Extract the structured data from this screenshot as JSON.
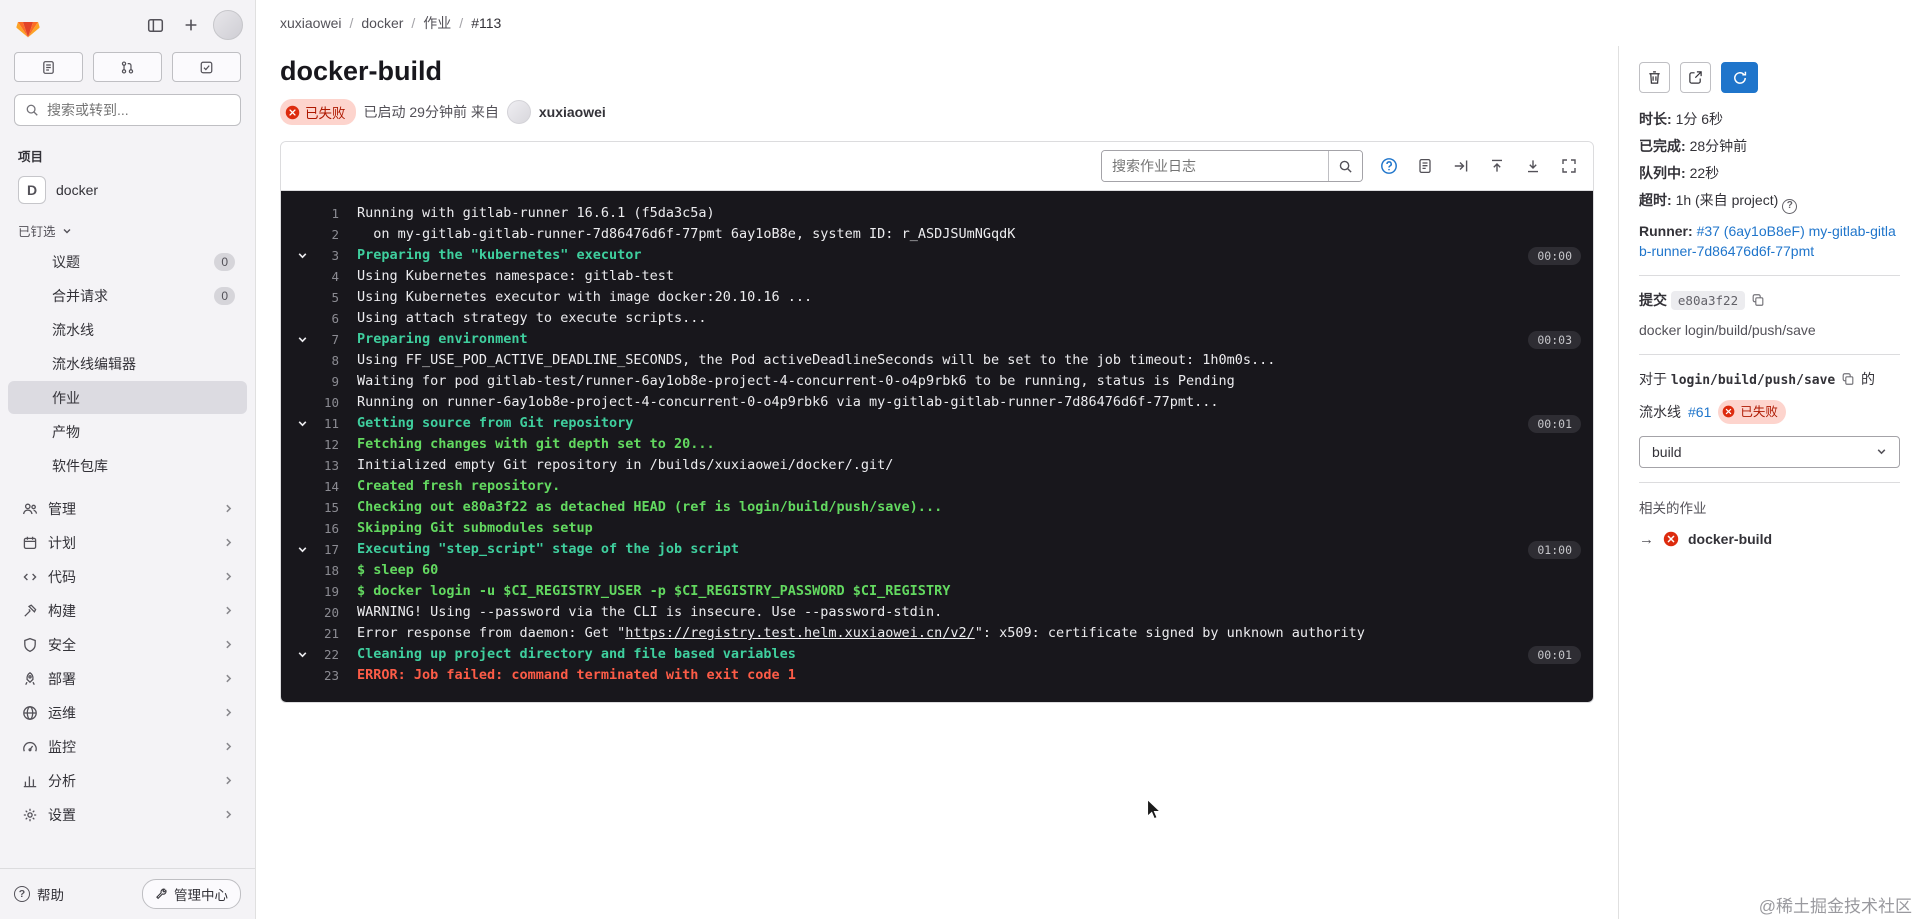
{
  "colors": {
    "accent_blue": "#1f75cb",
    "failed_red": "#dd2b0e",
    "failed_badge_bg": "#fdd4cd",
    "console_bg": "#18171c",
    "console_section_green": "#3fcf9e",
    "console_command_green": "#63d960",
    "console_error_red": "#fd5c47",
    "sidebar_bg": "#f4f3f6"
  },
  "breadcrumb": [
    "xuxiaowei",
    "docker",
    "作业",
    "#113"
  ],
  "sidebar": {
    "search_placeholder": "搜索或转到...",
    "section_label": "项目",
    "project": {
      "initial": "D",
      "name": "docker"
    },
    "pinned_label": "已钉选",
    "pinned_items": [
      {
        "key": "issues",
        "label": "议题",
        "badge": "0"
      },
      {
        "key": "merge-requests",
        "label": "合并请求",
        "badge": "0"
      },
      {
        "key": "pipelines",
        "label": "流水线"
      },
      {
        "key": "pipeline-editor",
        "label": "流水线编辑器"
      },
      {
        "key": "jobs",
        "label": "作业",
        "active": true
      },
      {
        "key": "artifacts",
        "label": "产物"
      },
      {
        "key": "package-registry",
        "label": "软件包库"
      }
    ],
    "menu_items": [
      {
        "key": "manage",
        "label": "管理",
        "icon": "users-icon"
      },
      {
        "key": "plan",
        "label": "计划",
        "icon": "calendar-icon"
      },
      {
        "key": "code",
        "label": "代码",
        "icon": "code-icon"
      },
      {
        "key": "build",
        "label": "构建",
        "icon": "hammer-icon"
      },
      {
        "key": "secure",
        "label": "安全",
        "icon": "shield-icon"
      },
      {
        "key": "deploy",
        "label": "部署",
        "icon": "rocket-icon"
      },
      {
        "key": "operate",
        "label": "运维",
        "icon": "globe-icon"
      },
      {
        "key": "monitor",
        "label": "监控",
        "icon": "gauge-icon"
      },
      {
        "key": "analyze",
        "label": "分析",
        "icon": "chart-icon"
      },
      {
        "key": "settings",
        "label": "设置",
        "icon": "gear-icon"
      }
    ],
    "footer": {
      "help": "帮助",
      "admin": "管理中心"
    }
  },
  "job": {
    "title": "docker-build",
    "status": "已失败",
    "started_text": "已启动 29分钟前 来自",
    "user": "xuxiaowei",
    "log_search_placeholder": "搜索作业日志"
  },
  "log": {
    "lines": [
      {
        "n": 1,
        "type": "normal",
        "text": "Running with gitlab-runner 16.6.1 (f5da3c5a)"
      },
      {
        "n": 2,
        "type": "normal",
        "text": "  on my-gitlab-gitlab-runner-7d86476d6f-77pmt 6ay1oB8e, system ID: r_ASDJSUmNGqdK"
      },
      {
        "n": 3,
        "type": "section",
        "text": "Preparing the \"kubernetes\" executor",
        "duration": "00:00"
      },
      {
        "n": 4,
        "type": "normal",
        "text": "Using Kubernetes namespace: gitlab-test"
      },
      {
        "n": 5,
        "type": "normal",
        "text": "Using Kubernetes executor with image docker:20.10.16 ..."
      },
      {
        "n": 6,
        "type": "normal",
        "text": "Using attach strategy to execute scripts..."
      },
      {
        "n": 7,
        "type": "section",
        "text": "Preparing environment",
        "duration": "00:03"
      },
      {
        "n": 8,
        "type": "normal",
        "text": "Using FF_USE_POD_ACTIVE_DEADLINE_SECONDS, the Pod activeDeadlineSeconds will be set to the job timeout: 1h0m0s..."
      },
      {
        "n": 9,
        "type": "normal",
        "text": "Waiting for pod gitlab-test/runner-6ay1ob8e-project-4-concurrent-0-o4p9rbk6 to be running, status is Pending"
      },
      {
        "n": 10,
        "type": "normal",
        "text": "Running on runner-6ay1ob8e-project-4-concurrent-0-o4p9rbk6 via my-gitlab-gitlab-runner-7d86476d6f-77pmt..."
      },
      {
        "n": 11,
        "type": "section",
        "text": "Getting source from Git repository",
        "duration": "00:01"
      },
      {
        "n": 12,
        "type": "green",
        "text": "Fetching changes with git depth set to 20..."
      },
      {
        "n": 13,
        "type": "normal",
        "text": "Initialized empty Git repository in /builds/xuxiaowei/docker/.git/"
      },
      {
        "n": 14,
        "type": "green",
        "text": "Created fresh repository."
      },
      {
        "n": 15,
        "type": "green",
        "text": "Checking out e80a3f22 as detached HEAD (ref is login/build/push/save)..."
      },
      {
        "n": 16,
        "type": "green",
        "text": "Skipping Git submodules setup"
      },
      {
        "n": 17,
        "type": "section",
        "text": "Executing \"step_script\" stage of the job script",
        "duration": "01:00"
      },
      {
        "n": 18,
        "type": "command",
        "text": "$ sleep 60"
      },
      {
        "n": 19,
        "type": "command",
        "text": "$ docker login -u $CI_REGISTRY_USER -p $CI_REGISTRY_PASSWORD $CI_REGISTRY"
      },
      {
        "n": 20,
        "type": "normal",
        "text": "WARNING! Using --password via the CLI is insecure. Use --password-stdin."
      },
      {
        "n": 21,
        "type": "normal",
        "text": "Error response from daemon: Get \"https://registry.test.helm.xuxiaowei.cn/v2/\": x509: certificate signed by unknown authority",
        "link": "https://registry.test.helm.xuxiaowei.cn/v2/"
      },
      {
        "n": 22,
        "type": "section",
        "text": "Cleaning up project directory and file based variables",
        "duration": "00:01"
      },
      {
        "n": 23,
        "type": "error",
        "text": "ERROR: Job failed: command terminated with exit code 1"
      }
    ]
  },
  "details": {
    "duration_label": "时长:",
    "duration": "1分 6秒",
    "finished_label": "已完成:",
    "finished": "28分钟前",
    "queued_label": "队列中:",
    "queued": "22秒",
    "timeout_label": "超时:",
    "timeout": "1h (来自 project)",
    "runner_label": "Runner:",
    "runner": "#37 (6ay1oB8eF) my-gitlab-gitlab-runner-7d86476d6f-77pmt",
    "commit_label": "提交",
    "commit_sha": "e80a3f22",
    "commit_title": "docker login/build/push/save",
    "ref_prefix": "对于",
    "ref": "login/build/push/save",
    "ref_suffix": "的",
    "pipeline_label": "流水线",
    "pipeline_id": "#61",
    "pipeline_status": "已失败",
    "stage_selected": "build",
    "related_jobs_label": "相关的作业",
    "related_job": "docker-build"
  },
  "watermark": "@稀土掘金技术社区"
}
